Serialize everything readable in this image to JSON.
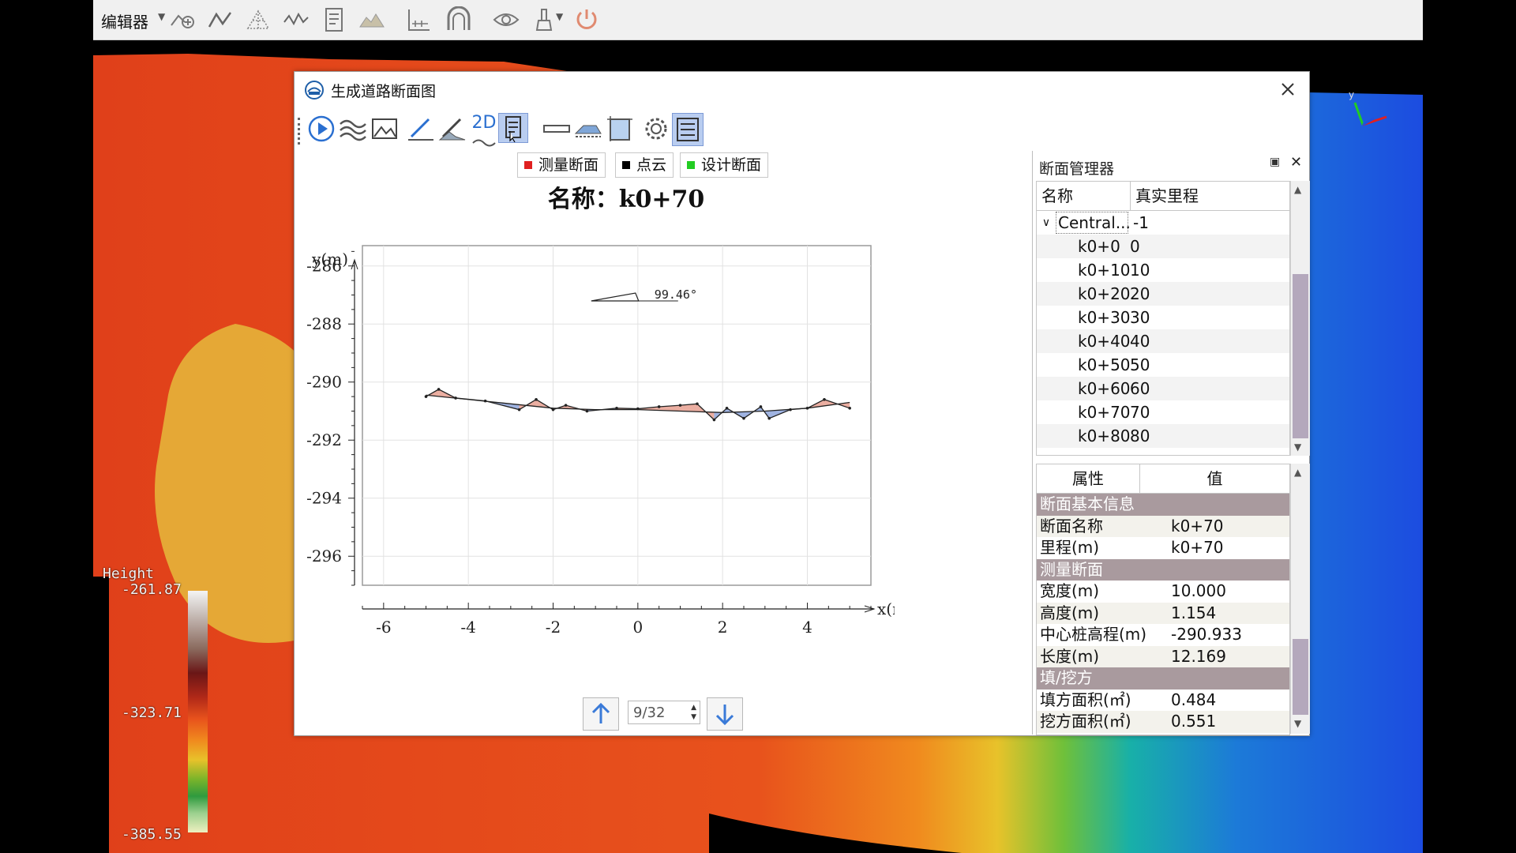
{
  "topbar": {
    "editor_label": "编辑器",
    "tools": [
      "add-vertex-icon",
      "polyline-icon",
      "tin-icon",
      "profile-line-icon",
      "document-icon",
      "terrain-icon",
      "measure-icon",
      "tunnel-icon",
      "eye-icon",
      "brush-icon",
      "power-icon"
    ]
  },
  "height_legend": {
    "title": "Height",
    "max": "-261.87",
    "mid": "-323.71",
    "min": "-385.55"
  },
  "dialog": {
    "title": "生成道路断面图",
    "toolbar": [
      "play-icon",
      "waves-icon",
      "image-icon",
      "pencil-icon",
      "pencil-area-icon",
      "2d-icon",
      "report-icon",
      "ruler-icon",
      "slope-icon",
      "frame-icon",
      "settings-icon",
      "list-icon"
    ],
    "toolbar_2d_text": "2D",
    "legend": [
      {
        "label": "测量断面",
        "color": "#e02020"
      },
      {
        "label": "点云",
        "color": "#000000"
      },
      {
        "label": "设计断面",
        "color": "#22cc22"
      }
    ],
    "plot_title": "名称：k0+70",
    "annotation": "99.46°",
    "nav": {
      "page": "9/32"
    }
  },
  "chart_data": {
    "type": "line",
    "title": "名称：k0+70",
    "xlabel": "x(m)",
    "ylabel": "y(m)",
    "xlim": [
      -6.5,
      5.5
    ],
    "ylim": [
      -297,
      -285.3
    ],
    "xticks": [
      -6,
      -4,
      -2,
      0,
      2,
      4
    ],
    "yticks": [
      -286,
      -288,
      -290,
      -292,
      -294,
      -296
    ],
    "grid": true,
    "series": [
      {
        "name": "测量断面",
        "color": "#e02020",
        "x": [
          -5.0,
          -4.7,
          -4.3,
          -3.6,
          -2.8,
          -2.4,
          -2.0,
          -1.7,
          -1.2,
          -0.5,
          0.0,
          0.5,
          1.0,
          1.4,
          1.8,
          2.1,
          2.5,
          2.9,
          3.1,
          3.6,
          4.0,
          4.4,
          5.0
        ],
        "y": [
          -290.5,
          -290.25,
          -290.55,
          -290.65,
          -290.95,
          -290.6,
          -290.95,
          -290.8,
          -291.0,
          -290.9,
          -290.92,
          -290.85,
          -290.8,
          -290.75,
          -291.3,
          -290.9,
          -291.25,
          -290.85,
          -291.25,
          -290.95,
          -290.9,
          -290.6,
          -290.9
        ]
      },
      {
        "name": "设计断面",
        "color": "#22cc22",
        "x": [
          -5.0,
          -4.0,
          -3.0,
          -2.0,
          -1.0,
          0.0,
          1.0,
          2.0,
          3.0,
          4.0,
          5.0
        ],
        "y": [
          -290.45,
          -290.6,
          -290.75,
          -290.9,
          -290.95,
          -290.95,
          -291.0,
          -291.05,
          -291.0,
          -290.9,
          -290.7
        ]
      }
    ]
  },
  "section_manager": {
    "title": "断面管理器",
    "columns": [
      "名称",
      "真实里程"
    ],
    "root": {
      "name": "Central...",
      "value": "-1"
    },
    "rows": [
      {
        "name": "k0+0",
        "value": "0"
      },
      {
        "name": "k0+10",
        "value": "10"
      },
      {
        "name": "k0+20",
        "value": "20"
      },
      {
        "name": "k0+30",
        "value": "30"
      },
      {
        "name": "k0+40",
        "value": "40"
      },
      {
        "name": "k0+50",
        "value": "50"
      },
      {
        "name": "k0+60",
        "value": "60"
      },
      {
        "name": "k0+70",
        "value": "70"
      },
      {
        "name": "k0+80",
        "value": "80"
      }
    ]
  },
  "properties": {
    "columns": [
      "属性",
      "值"
    ],
    "section_basic": "断面基本信息",
    "section_name_key": "断面名称",
    "section_name_val": "k0+70",
    "mileage_key": "里程(m)",
    "mileage_val": "k0+70",
    "section_survey": "测量断面",
    "width_key": "宽度(m)",
    "width_val": "10.000",
    "height_key": "高度(m)",
    "height_val": "1.154",
    "center_key": "中心桩高程(m)",
    "center_val": "-290.933",
    "length_key": "长度(m)",
    "length_val": "12.169",
    "section_cutfill": "填/挖方",
    "fill_key": "填方面积(㎡)",
    "fill_val": "0.484",
    "cut_key": "挖方面积(㎡)",
    "cut_val": "0.551"
  }
}
